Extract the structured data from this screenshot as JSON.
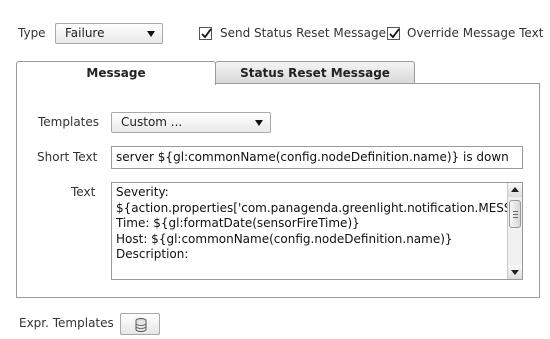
{
  "type_row": {
    "label": "Type",
    "value": "Failure",
    "send_status_reset": {
      "label": "Send Status Reset Message",
      "checked": true
    },
    "override_message": {
      "label": "Override Message Text",
      "checked": true
    }
  },
  "tabs": [
    {
      "label": "Message",
      "active": true
    },
    {
      "label": "Status Reset Message",
      "active": false
    }
  ],
  "form": {
    "templates_label": "Templates",
    "templates_value": "Custom ...",
    "short_text_label": "Short Text",
    "short_text_value": "server ${gl:commonName(config.nodeDefinition.name)} is down",
    "text_label": "Text",
    "text_value": "Severity:\n${action.properties['com.panagenda.greenlight.notification.MESSAGE_TYPE']}\nTime: ${gl:formatDate(sensorFireTime)}\nHost: ${gl:commonName(config.nodeDefinition.name)}\nDescription:"
  },
  "footer": {
    "expr_templates_label": "Expr. Templates",
    "icon": "database-icon"
  }
}
